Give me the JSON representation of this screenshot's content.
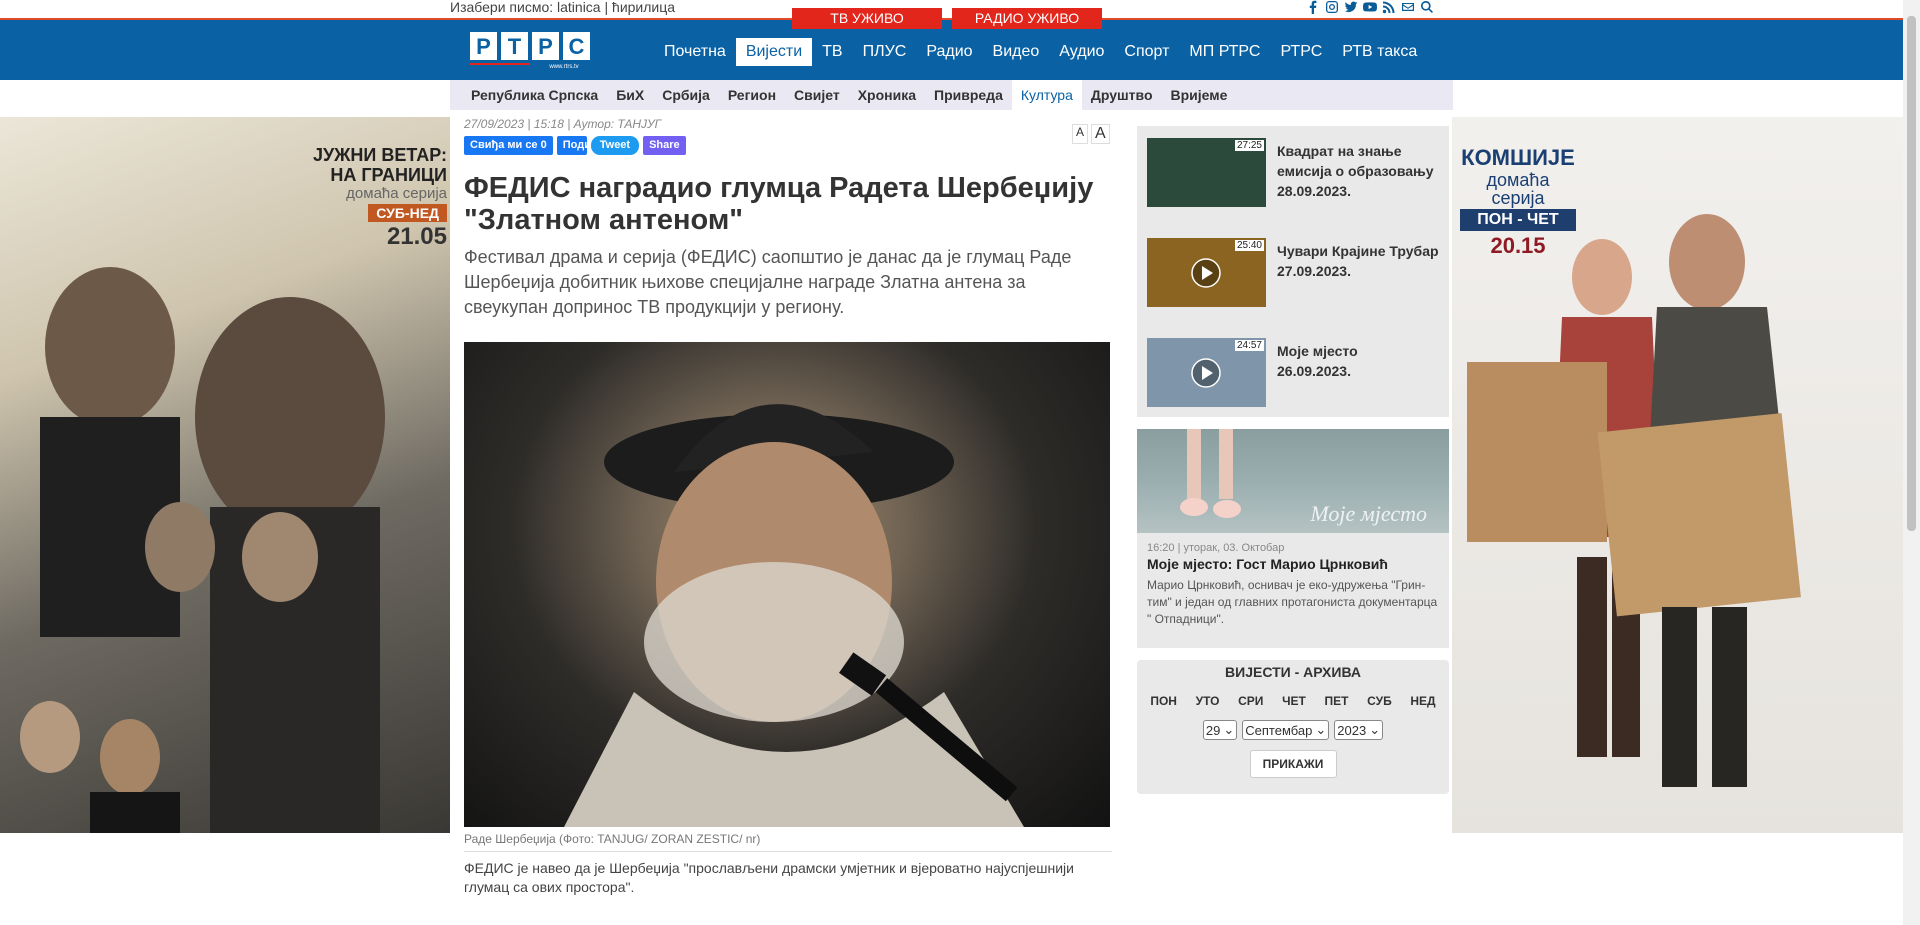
{
  "topbar": {
    "script_prompt": "Изабери писмо:",
    "latin": "latinica",
    "cyrillic": "ћирилица",
    "tv_live": "ТВ УЖИВО",
    "radio_live": "РАДИО УЖИВО"
  },
  "social_icons": [
    "facebook-icon",
    "instagram-icon",
    "twitter-icon",
    "youtube-icon",
    "rss-icon",
    "mail-icon",
    "search-icon"
  ],
  "brand": {
    "logo_letters": [
      "Р",
      "Т",
      "Р",
      "С"
    ],
    "logo_url_text": "www.rtrs.tv",
    "primary": "#0a62a5",
    "accent": "#e2261c"
  },
  "nav": {
    "items": [
      "Почетна",
      "Вијести",
      "ТВ",
      "ПЛУС",
      "Радио",
      "Видео",
      "Аудио",
      "Спорт",
      "МП РТРС",
      "РТРС",
      "РТВ такса"
    ],
    "active": "Вијести"
  },
  "subnav": {
    "items": [
      "Република Српска",
      "БиХ",
      "Србија",
      "Регион",
      "Свијет",
      "Хроника",
      "Привреда",
      "Култура",
      "Друштво",
      "Вријеме"
    ],
    "active": "Култура"
  },
  "ad_left": {
    "line1": "ЈУЖНИ ВЕТАР:",
    "line2": "НА ГРАНИЦИ",
    "line3": "домаћа серија",
    "days": "СУБ-НЕД",
    "time": "21.05"
  },
  "ad_right": {
    "line1": "КОМШИЈЕ",
    "line2": "домаћа серија",
    "days": "ПОН - ЧЕТ",
    "time": "20.15"
  },
  "article": {
    "meta": "27/09/2023 |  15:18 | Аутор: ТАНЈУГ",
    "share": {
      "fb_like": "Свиђа ми се 0",
      "fb_share": "Подијели",
      "tweet": "Tweet",
      "viber": "Share"
    },
    "font_small": "A",
    "font_large": "A",
    "title": "ФЕДИС наградио глумца Радета Шербеџију \"Златном антеном\"",
    "lead": "Фестивал драма и серија (ФЕДИС) саопштио је данас да је глумац Раде Шербеџија добитник њихове специјалне награде Златна антена за свеукупан допринос ТВ продукцији у региону.",
    "caption": "Раде Шербеџија (Фото: TANJUG/ ZORAN ZESTIC/ nr)",
    "body": "ФЕДИС је навео да је Шербеџија \"прослављени драмски умјетник и вјероватно најуспјешнији глумац са ових простора\"."
  },
  "sidebar": {
    "videos": [
      {
        "title": "Квадрат на знање емисија о образовању",
        "date": "28.09.2023.",
        "duration": "27:25",
        "color": "#2b4a3c"
      },
      {
        "title": "Чувари Крајине Трубар",
        "date": "27.09.2023.",
        "duration": "25:40",
        "color": "#8a6420"
      },
      {
        "title": "Моје мјесто",
        "date": "26.09.2023.",
        "duration": "24:57",
        "color": "#7f96aa"
      }
    ],
    "promo": {
      "image_text": "Моје мјесто",
      "meta": "16:20 | уторак, 03. Октобар",
      "title": "Моје мјесто: Гост Марио Црнковић",
      "desc": "Марио Црнковић, оснивач је еко-удружења \"Грин-тим\" и један од главних протагониста документарца \" Отпадници\"."
    },
    "archive": {
      "title": "ВИЈЕСТИ - АРХИВА",
      "days": [
        "ПОН",
        "УТО",
        "СРИ",
        "ЧЕТ",
        "ПЕТ",
        "СУБ",
        "НЕД"
      ],
      "day": "29",
      "month": "Септембар",
      "year": "2023",
      "button": "ПРИКАЖИ"
    }
  }
}
